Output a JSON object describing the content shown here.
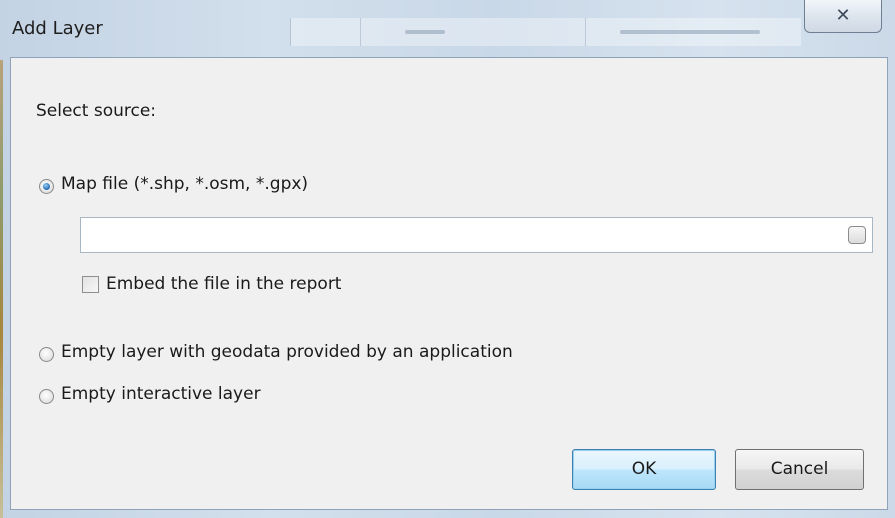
{
  "window": {
    "title": "Add Layer",
    "close_glyph": "✕"
  },
  "dialog": {
    "prompt": "Select source:",
    "options": [
      {
        "label": "Map file (*.shp, *.osm, *.gpx)",
        "selected": true
      },
      {
        "label": "Empty layer with geodata provided by an application",
        "selected": false
      },
      {
        "label": "Empty interactive layer",
        "selected": false
      }
    ],
    "file_path": {
      "value": "",
      "placeholder": ""
    },
    "embed_checkbox": {
      "label": "Embed the file in the report",
      "checked": false
    },
    "ok_label": "OK",
    "cancel_label": "Cancel"
  },
  "icons": {
    "close": "close-icon",
    "browse": "browse-icon"
  },
  "colors": {
    "default_button_border": "#3c7fb1",
    "radio_selected": "#2c74b8"
  }
}
